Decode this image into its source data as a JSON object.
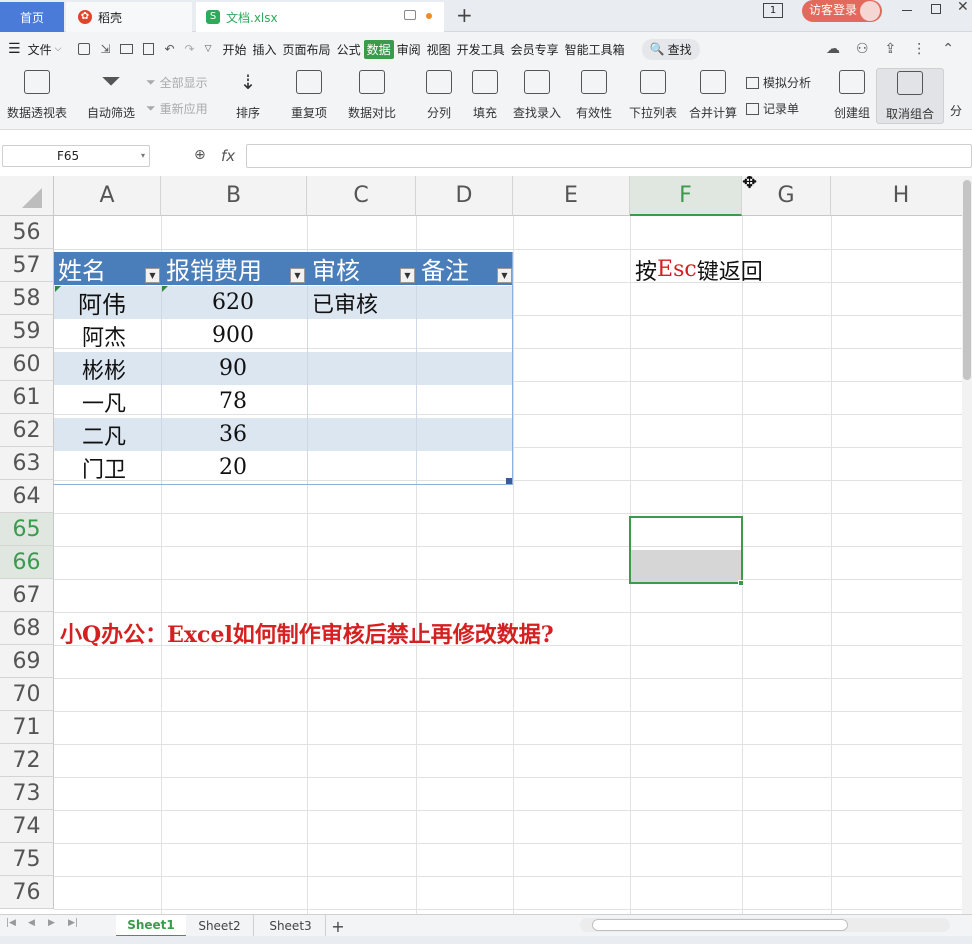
{
  "tabs": {
    "home": "首页",
    "daoke": "稻壳",
    "doc": "文档.xlsx"
  },
  "titlebar": {
    "page_num": "1",
    "login": "访客登录"
  },
  "menu": {
    "file": "文件",
    "items": [
      "开始",
      "插入",
      "页面布局",
      "公式",
      "数据",
      "审阅",
      "视图",
      "开发工具",
      "会员专享",
      "智能工具箱"
    ],
    "active": "数据",
    "search": "查找"
  },
  "ribbon": {
    "pivot": "数据透视表",
    "autofilter": "自动筛选",
    "show_all": "全部显示",
    "reapply": "重新应用",
    "sort": "排序",
    "dup": "重复项",
    "compare": "数据对比",
    "split": "分列",
    "fill": "填充",
    "lookup": "查找录入",
    "validity": "有效性",
    "dropdown": "下拉列表",
    "consolidate": "合并计算",
    "whatif": "模拟分析",
    "record": "记录单",
    "group": "创建组",
    "ungroup": "取消组合",
    "more": "分"
  },
  "formula": {
    "namebox": "F65",
    "fx": "fx"
  },
  "columns": [
    "A",
    "B",
    "C",
    "D",
    "E",
    "F",
    "G",
    "H"
  ],
  "rows": [
    "56",
    "57",
    "58",
    "59",
    "60",
    "61",
    "62",
    "63",
    "64",
    "65",
    "66",
    "67",
    "68",
    "69",
    "70",
    "71",
    "72",
    "73",
    "74",
    "75",
    "76"
  ],
  "table": {
    "headers": [
      "姓名",
      "报销费用",
      "审核",
      "备注"
    ],
    "rows": [
      {
        "name": "阿伟",
        "amount": "620",
        "status": "已审核"
      },
      {
        "name": "阿杰",
        "amount": "900",
        "status": ""
      },
      {
        "name": "彬彬",
        "amount": "90",
        "status": ""
      },
      {
        "name": "一凡",
        "amount": "78",
        "status": ""
      },
      {
        "name": "二凡",
        "amount": "36",
        "status": ""
      },
      {
        "name": "门卫",
        "amount": "20",
        "status": ""
      }
    ]
  },
  "note": {
    "pre": "按",
    "key": "Esc",
    "post": "键返回"
  },
  "caption": "小Q办公：Excel如何制作审核后禁止再修改数据?",
  "sheets": [
    "Sheet1",
    "Sheet2",
    "Sheet3"
  ],
  "active_sheet": "Sheet1",
  "colors": {
    "accent_green": "#3c9a4d",
    "header_blue": "#4a7ebb",
    "band_blue": "#dce6f1",
    "caption_red": "#d42020"
  }
}
